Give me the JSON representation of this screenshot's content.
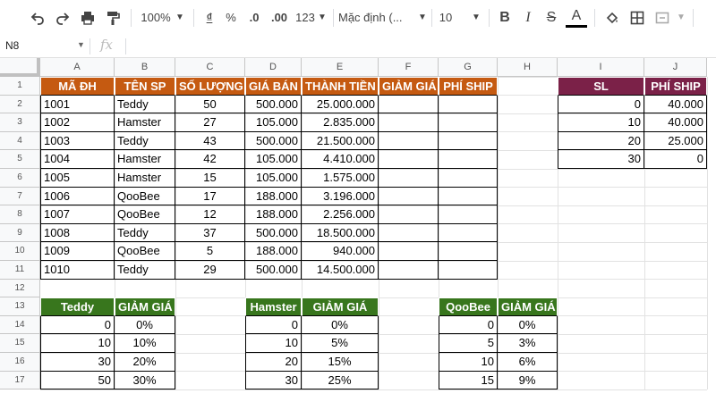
{
  "toolbar": {
    "zoom": "100%",
    "currency": "₫",
    "percent": "%",
    "dec_less": ".0",
    "dec_more": ".00",
    "more_formats": "123",
    "font": "Mặc định (...",
    "font_size": "10",
    "bold": "B",
    "italic": "I",
    "strike": "S",
    "text_color": "A"
  },
  "formula_bar": {
    "cell_ref": "N8",
    "fx": "fx"
  },
  "columns": [
    "A",
    "B",
    "C",
    "D",
    "E",
    "F",
    "G",
    "H",
    "I",
    "J"
  ],
  "rows": [
    "1",
    "2",
    "3",
    "4",
    "5",
    "6",
    "7",
    "8",
    "9",
    "10",
    "11",
    "12",
    "13",
    "14",
    "15",
    "16",
    "17"
  ],
  "orders": {
    "headers": [
      "MÃ ĐH",
      "TÊN SP",
      "SỐ LƯỢNG",
      "GIÁ BÁN",
      "THÀNH TIỀN",
      "GIẢM GIÁ",
      "PHÍ SHIP"
    ],
    "rows": [
      [
        "1001",
        "Teddy",
        "50",
        "500.000",
        "25.000.000"
      ],
      [
        "1002",
        "Hamster",
        "27",
        "105.000",
        "2.835.000"
      ],
      [
        "1003",
        "Teddy",
        "43",
        "500.000",
        "21.500.000"
      ],
      [
        "1004",
        "Hamster",
        "42",
        "105.000",
        "4.410.000"
      ],
      [
        "1005",
        "Hamster",
        "15",
        "105.000",
        "1.575.000"
      ],
      [
        "1006",
        "QooBee",
        "17",
        "188.000",
        "3.196.000"
      ],
      [
        "1007",
        "QooBee",
        "12",
        "188.000",
        "2.256.000"
      ],
      [
        "1008",
        "Teddy",
        "37",
        "500.000",
        "18.500.000"
      ],
      [
        "1009",
        "QooBee",
        "5",
        "188.000",
        "940.000"
      ],
      [
        "1010",
        "Teddy",
        "29",
        "500.000",
        "14.500.000"
      ]
    ]
  },
  "ship": {
    "headers": [
      "SL",
      "PHÍ SHIP"
    ],
    "rows": [
      [
        "0",
        "40.000"
      ],
      [
        "10",
        "40.000"
      ],
      [
        "20",
        "25.000"
      ],
      [
        "30",
        "0"
      ]
    ]
  },
  "discounts": [
    {
      "headers": [
        "Teddy",
        "GIẢM GIÁ"
      ],
      "rows": [
        [
          "0",
          "0%"
        ],
        [
          "10",
          "10%"
        ],
        [
          "30",
          "20%"
        ],
        [
          "50",
          "30%"
        ]
      ]
    },
    {
      "headers": [
        "Hamster",
        "GIẢM GIÁ"
      ],
      "rows": [
        [
          "0",
          "0%"
        ],
        [
          "10",
          "5%"
        ],
        [
          "20",
          "15%"
        ],
        [
          "30",
          "25%"
        ]
      ]
    },
    {
      "headers": [
        "QooBee",
        "GIẢM GIÁ"
      ],
      "rows": [
        [
          "0",
          "0%"
        ],
        [
          "5",
          "3%"
        ],
        [
          "10",
          "6%"
        ],
        [
          "15",
          "9%"
        ]
      ]
    }
  ],
  "colors": {
    "orange": "#c55a11",
    "maroon": "#7b2148",
    "green": "#38761d"
  }
}
